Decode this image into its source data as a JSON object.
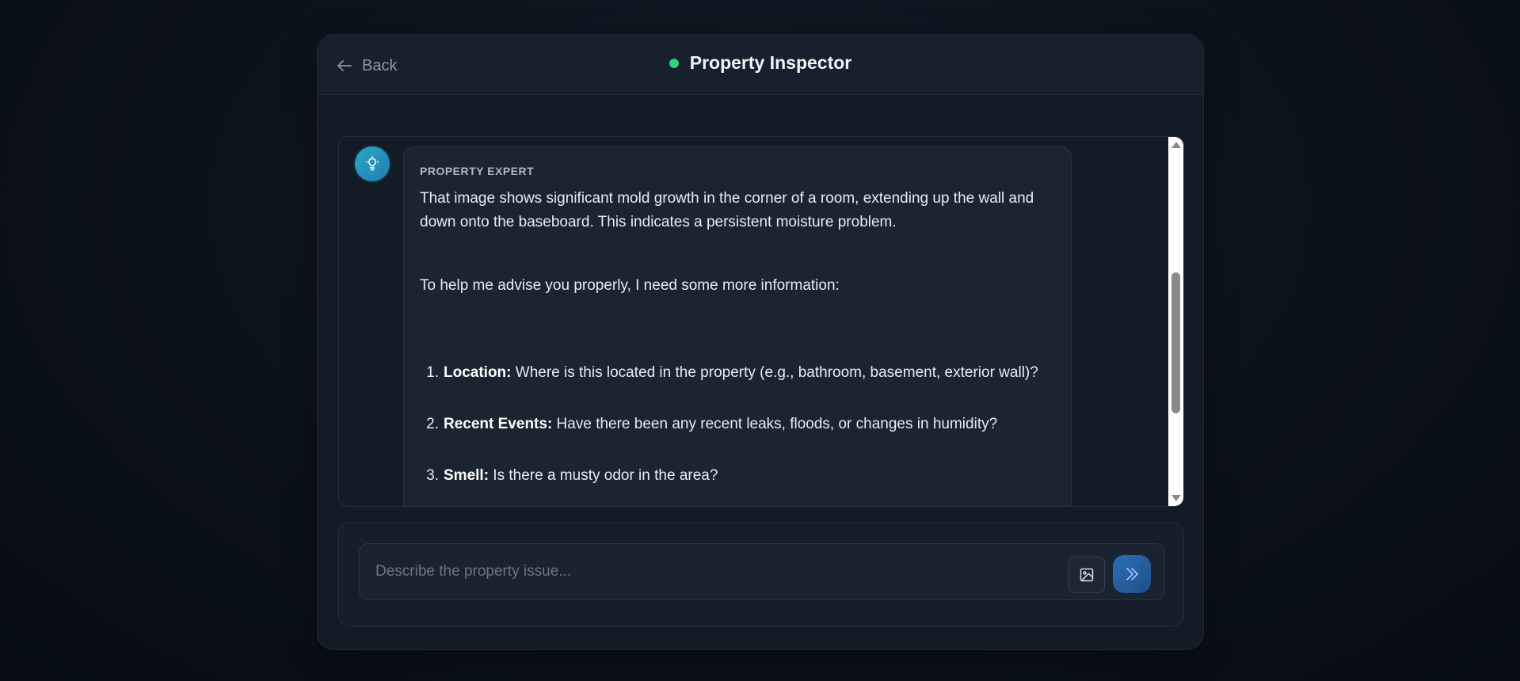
{
  "header": {
    "back_label": "Back",
    "title": "Property Inspector",
    "status_color": "#33d17a"
  },
  "message": {
    "sender": "PROPERTY EXPERT",
    "paragraph1": "That image shows significant mold growth in the corner of a room, extending up the wall and down onto the baseboard. This indicates a persistent moisture problem.",
    "paragraph2": "To help me advise you properly, I need some more information:",
    "items": [
      {
        "num": "1.",
        "label": "Location:",
        "text": " Where is this located in the property (e.g., bathroom, basement, exterior wall)?"
      },
      {
        "num": "2.",
        "label": "Recent Events:",
        "text": " Have there been any recent leaks, floods, or changes in humidity?"
      },
      {
        "num": "3.",
        "label": "Smell:",
        "text": " Is there a musty odor in the area?"
      }
    ]
  },
  "composer": {
    "placeholder": "Describe the property issue...",
    "value": ""
  },
  "icons": {
    "back": "arrow-left-icon",
    "avatar": "lightbulb-icon",
    "attach": "image-icon",
    "send": "chevrons-right-icon"
  },
  "colors": {
    "accent": "#2aa7c7",
    "send_button": "#2c6fb5"
  }
}
